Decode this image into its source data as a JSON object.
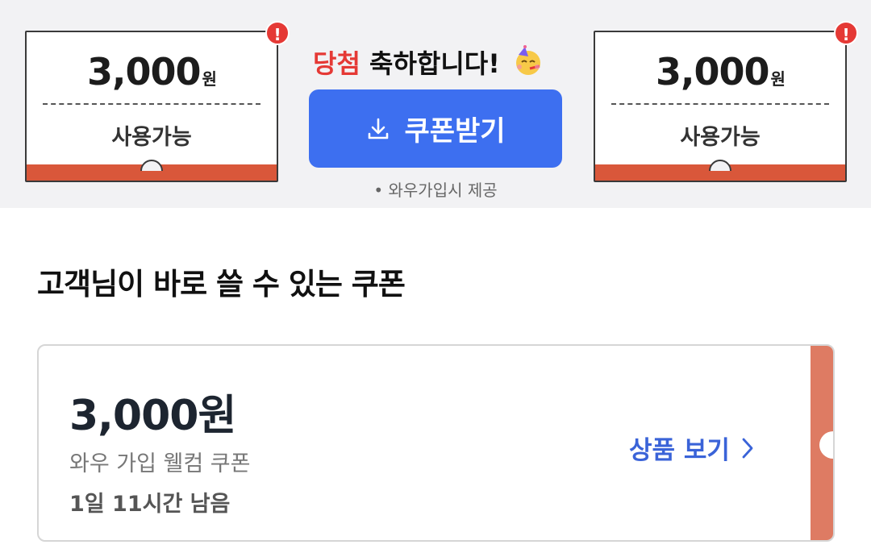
{
  "banner": {
    "left_coupon": {
      "amount": "3,000",
      "unit": "원",
      "status": "사용가능",
      "alert": "!"
    },
    "right_coupon": {
      "amount": "3,000",
      "unit": "원",
      "status": "사용가능",
      "alert": "!"
    },
    "congrats_highlight": "당첨",
    "congrats_rest": " 축하합니다!",
    "download_label": "쿠폰받기",
    "note": "• 와우가입시 제공",
    "colors": {
      "accent": "#3d6ff0",
      "ticket_bar": "#d9573a",
      "alert": "#e53935"
    }
  },
  "section": {
    "title": "고객님이 바로 쓸 수 있는 쿠폰"
  },
  "coupon": {
    "amount": "3,000원",
    "name": "와우 가입 웰컴 쿠폰",
    "remaining": "1일 11시간 남음",
    "view_label": "상품 보기",
    "strip_color": "#de7b63"
  }
}
